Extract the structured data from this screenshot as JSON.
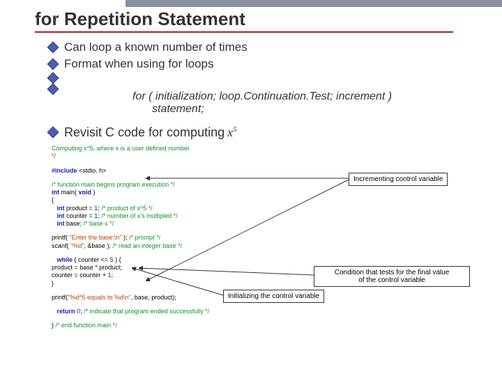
{
  "title": "for Repetition Statement",
  "bullets": {
    "b1": "Can loop a known number of times",
    "b2": "Format when using for loops"
  },
  "format": {
    "l1": "for ( initialization; loop.Continuation.Test; increment )",
    "l2": "statement;"
  },
  "revisit": {
    "text": "Revisit C code for computing ",
    "var": "x",
    "exp": "5"
  },
  "code": {
    "c1a": "   Computing x^5, where x is a user defined number",
    "c1b": "*/",
    "c2a": "#include",
    "c2b": " <stdio. h>",
    "c3": "/* function main begins program execution */",
    "c4a": "int",
    "c4b": " main( ",
    "c4c": "void",
    "c4d": " )",
    "c5": "{",
    "c6a": "int",
    "c6b": " product = ",
    "c6c": "1",
    "c6d": "; ",
    "c6e": "/* product of x^5 */",
    "c7a": "int",
    "c7b": " counter = ",
    "c7c": "1",
    "c7d": "; ",
    "c7e": "/* number of x's multipled */",
    "c8a": "int",
    "c8b": " base;    ",
    "c8e": "/* base x */",
    "c9a": "   printf( ",
    "c9b": "\"Enter the base:\\n\"",
    "c9c": " );   ",
    "c9d": "/* prompt */",
    "c10a": "   scanf( ",
    "c10b": "\"%d\"",
    "c10c": ", &base );         ",
    "c10d": "/* read an integer base */",
    "c11a": "while",
    "c11b": " ( counter <= ",
    "c11c": "5",
    "c11d": " ) {",
    "c12": "      product = base * product;",
    "c13a": "      counter = counter + ",
    "c13b": "1",
    "c13c": ";",
    "c14": "   }",
    "c15a": "   printf(",
    "c15b": "\"%d^5 equals to %d\\n\"",
    "c15c": ", base, product);",
    "c16a": "return",
    "c16b": " ",
    "c16c": "0",
    "c16d": "; ",
    "c16e": "/* indicate that program ended successfully */",
    "c17a": "} ",
    "c17b": "/* end function main */"
  },
  "callouts": {
    "inc": "Incrementing control variable",
    "cond1": "Condition that tests for the final value",
    "cond2": "of the control variable",
    "init": "Initializing the control variable"
  }
}
